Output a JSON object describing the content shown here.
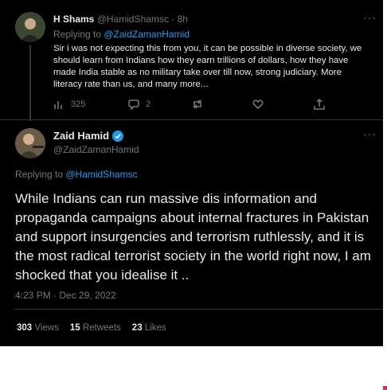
{
  "reply_tweet": {
    "name": "H Shams",
    "handle": "@HamidShamsc",
    "time": "· 8h",
    "replying_prefix": "Replying to ",
    "replying_handle": "@ZaidZamanHamid",
    "text": "Sir i was not expecting this from you, it can be possible in diverse society, we should learn from Indians how they earn trillions of dollars, how they have made India stable as no military take over till now, strong judiciary. More literacy rate than us, and many more...",
    "views": "325",
    "replies": "2"
  },
  "main_tweet": {
    "name": "Zaid Hamid",
    "handle": "@ZaidZamanHamid",
    "replying_prefix": "Replying to ",
    "replying_handle": "@HamidShamsc",
    "text": "While Indians can run massive dis information and propaganda campaigns about internal fractures in Pakistan and support insurgencies and terrorism ruthlessly, and it is the most radical terrorist society in the world right now, I am shocked that you idealise it ..",
    "timestamp": "4:23 PM · Dec 29, 2022",
    "views_count": "303",
    "views_label": "Views",
    "retweets_count": "15",
    "retweets_label": "Retweets",
    "likes_count": "23",
    "likes_label": "Likes"
  },
  "more_icon_text": "···",
  "colors": {
    "accent": "#1d9bf0",
    "muted": "#71767b",
    "background": "#000000",
    "text": "#e7e9ea"
  }
}
